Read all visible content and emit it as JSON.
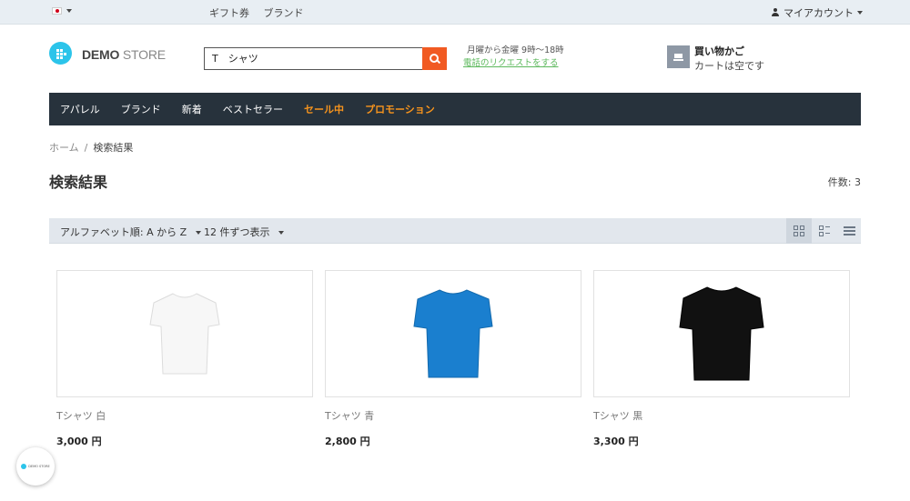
{
  "topbar": {
    "language_flag": "jp-flag-icon",
    "links": [
      "ギフト券",
      "ブランド"
    ],
    "account_label": "マイアカウント"
  },
  "header": {
    "logo_bold": "DEMO",
    "logo_light": " STORE",
    "search": {
      "value": "T　シャツ",
      "placeholder": ""
    },
    "hours": "月曜から金曜 9時～18時",
    "callback_link": "電話のリクエストをする",
    "cart": {
      "title": "買い物かご",
      "status": "カートは空です"
    }
  },
  "nav": {
    "items": [
      "アパレル",
      "ブランド",
      "新着",
      "ベストセラー",
      "セール中",
      "プロモーション"
    ]
  },
  "breadcrumb": {
    "home": "ホーム",
    "separator": "/",
    "current": "検索結果"
  },
  "page": {
    "title": "検索結果",
    "count": "件数: 3"
  },
  "toolbar": {
    "sort": "アルファベット順: A から Z",
    "per_page": "12 件ずつ表示",
    "views": [
      "grid-view-icon",
      "list-grid-view-icon",
      "list-view-icon"
    ]
  },
  "products": [
    {
      "name": "Tシャツ 白",
      "price": "3,000 円",
      "color": "#f5f5f5"
    },
    {
      "name": "Tシャツ 青",
      "price": "2,800 円",
      "color": "#1a7fcf"
    },
    {
      "name": "Tシャツ 黒",
      "price": "3,300 円",
      "color": "#111111"
    }
  ],
  "badge": {
    "text": "DEMO STORE"
  },
  "colors": {
    "accent": "#f15a22",
    "nav_bg": "#27323c",
    "promo": "#f7941d",
    "logo": "#2cc4ea"
  }
}
